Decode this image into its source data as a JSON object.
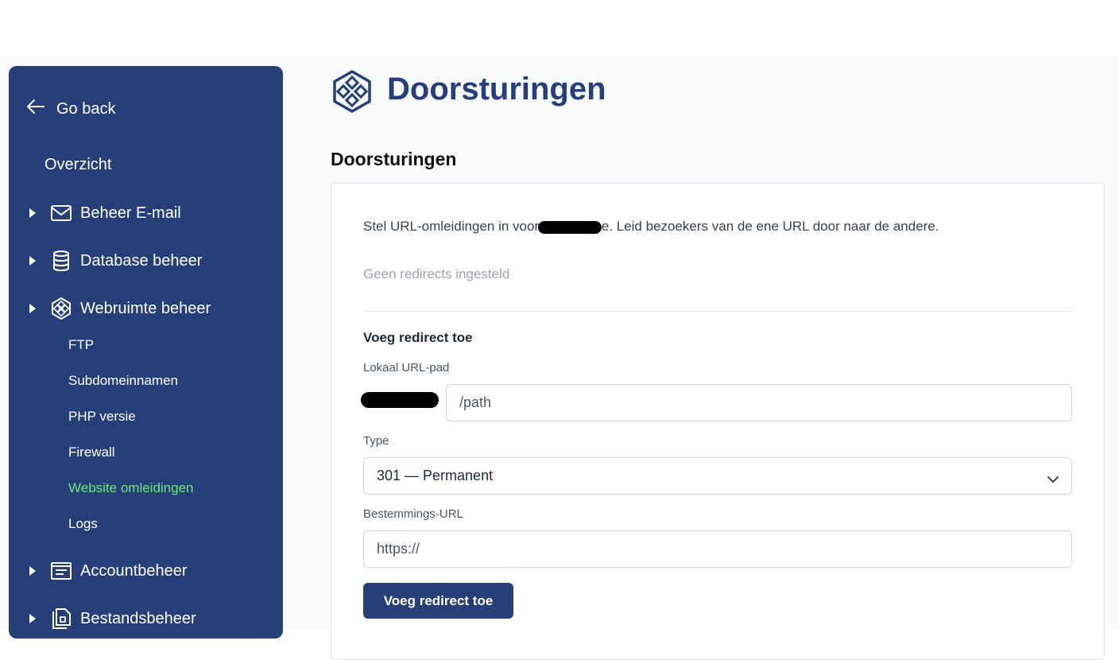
{
  "sidebar": {
    "go_back": "Go back",
    "overview": "Overzicht",
    "groups": [
      {
        "label": "Beheer E-mail",
        "icon": "mail-icon"
      },
      {
        "label": "Database beheer",
        "icon": "database-icon"
      },
      {
        "label": "Webruimte beheer",
        "icon": "webspace-icon"
      },
      {
        "label": "Accountbeheer",
        "icon": "account-icon"
      },
      {
        "label": "Bestandsbeheer",
        "icon": "files-icon"
      }
    ],
    "sub_items": [
      "FTP",
      "Subdomeinnamen",
      "PHP versie",
      "Firewall",
      "Website omleidingen",
      "Logs"
    ],
    "active_sub_item": "Website omleidingen"
  },
  "header": {
    "title": "Doorsturingen",
    "icon": "webspace-icon"
  },
  "section": {
    "title": "Doorsturingen",
    "intro_before": "Stel URL-omleidingen in voor ",
    "intro_after": "e. Leid bezoekers van de ene URL door naar de andere.",
    "empty_note": "Geen redirects ingesteld",
    "form": {
      "title": "Voeg redirect toe",
      "local_path_label": "Lokaal URL-pad",
      "local_path_placeholder": "/path",
      "type_label": "Type",
      "type_value": "301 — Permanent",
      "destination_label": "Bestemmings-URL",
      "destination_placeholder": "https://",
      "submit_label": "Voeg redirect toe"
    }
  },
  "colors": {
    "brand": "#263f79",
    "active_nav": "#6ee87a",
    "background": "#f8f9fb"
  }
}
